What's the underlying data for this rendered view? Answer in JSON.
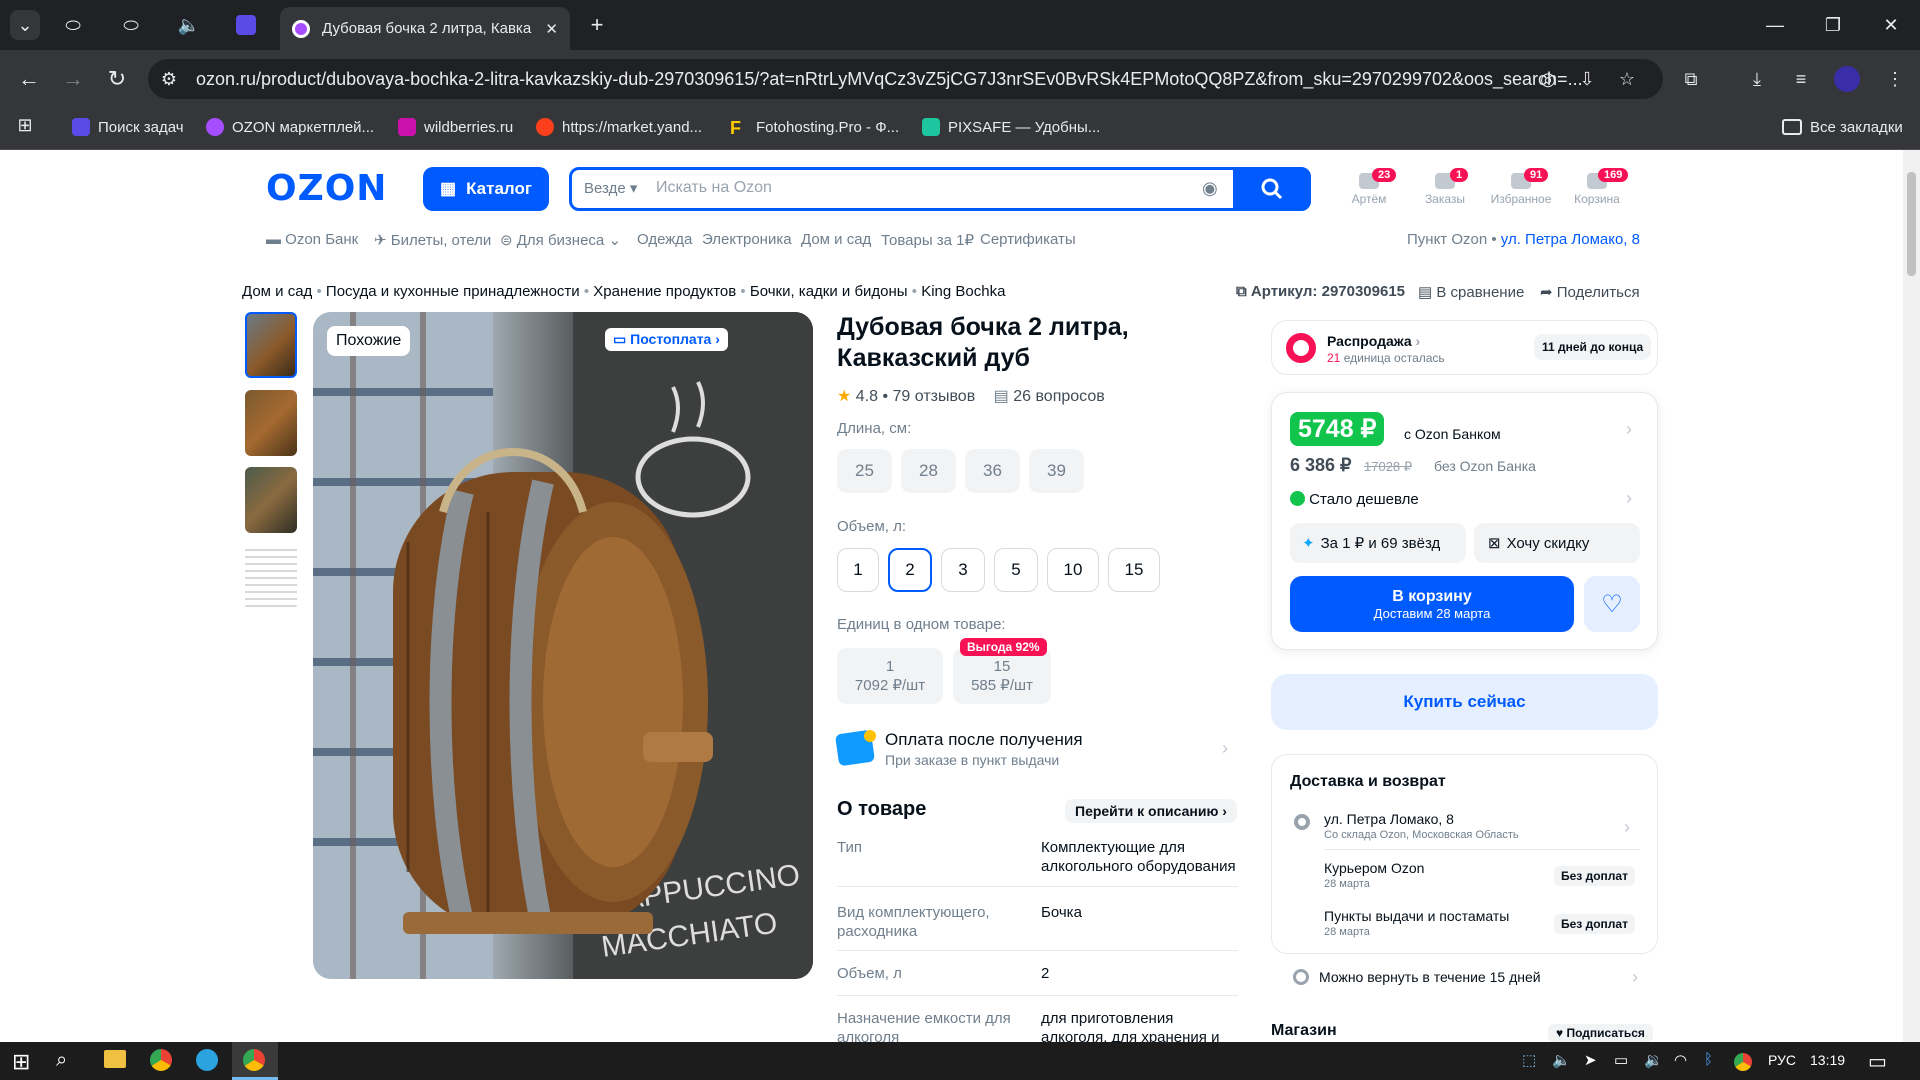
{
  "browser": {
    "tab_title": "Дубовая бочка 2 литра, Кавка",
    "url": "ozon.ru/product/dubovaya-bochka-2-litra-kavkazskiy-dub-2970309615/?at=nRtrLyMVqCz3vZ5jCG7J3nrSEv0BvRSk4EPMotoQQ8PZ&from_sku=2970299702&oos_search=...",
    "bookmarks": [
      "Поиск задач",
      "OZON маркетплей...",
      "wildberries.ru",
      "https://market.yand...",
      "Fotohosting.Pro - Ф...",
      "PIXSAFE — Удобны..."
    ],
    "all_bookmarks": "Все закладки"
  },
  "header": {
    "logo": "OZON",
    "catalog": "Каталог",
    "search_scope": "Везде",
    "search_placeholder": "Искать на Ozon",
    "icons": [
      {
        "label": "Артём",
        "count": "23"
      },
      {
        "label": "Заказы",
        "count": "1"
      },
      {
        "label": "Избранное",
        "count": "91"
      },
      {
        "label": "Корзина",
        "count": "169"
      }
    ],
    "nav": [
      "Ozon Банк",
      "Билеты, отели",
      "Для бизнеса",
      "Одежда",
      "Электроника",
      "Дом и сад",
      "Товары за 1₽",
      "Сертификаты"
    ],
    "pickup_label": "Пункт Ozon •",
    "pickup_address": "ул. Петра Ломако, 8"
  },
  "breadcrumbs": [
    "Дом и сад",
    "Посуда и кухонные принадлежности",
    "Хранение продуктов",
    "Бочки, кадки и бидоны",
    "King Bochka"
  ],
  "article": "Артикул: 2970309615",
  "compare": "В сравнение",
  "share": "Поделиться",
  "gallery": {
    "similar": "Похожие",
    "postpay": "Постоплата"
  },
  "product": {
    "title_line1": "Дубовая бочка 2 литра,",
    "title_line2": "Кавказский дуб",
    "rating": "4.8 • 79 отзывов",
    "questions": "26 вопросов",
    "length_label": "Длина, см:",
    "lengths": [
      "25",
      "28",
      "36",
      "39"
    ],
    "volume_label": "Объем, л:",
    "volumes": [
      "1",
      "2",
      "3",
      "5",
      "10",
      "15"
    ],
    "selected_volume": "2",
    "units_label": "Единиц в одном товаре:",
    "units": [
      {
        "count": "1",
        "price": "7092 ₽/шт"
      },
      {
        "count": "15",
        "price": "585 ₽/шт",
        "badge": "Выгода 92%"
      }
    ],
    "payment_title": "Оплата после получения",
    "payment_sub": "При заказе в пункт выдачи",
    "about_title": "О товаре",
    "about_link": "Перейти к описанию",
    "specs": [
      {
        "k": "Тип",
        "v": "Комплектующие для алкогольного оборудования"
      },
      {
        "k": "Вид комплектующего, расходника",
        "v": "Бочка"
      },
      {
        "k": "Объем, л",
        "v": "2"
      },
      {
        "k": "Назначение емкости для алкоголя",
        "v": "для приготовления алкоголя, для хранения и"
      }
    ]
  },
  "sale": {
    "title": "Распродажа",
    "count": "21",
    "left": "единица осталась",
    "days": "11 дней до конца"
  },
  "price": {
    "bank_price": "5748 ₽",
    "bank_label": "с Ozon Банком",
    "price": "6 386 ₽",
    "old_price": "17028 ₽",
    "no_bank": "без Ozon Банка",
    "cheaper": "Стало дешевле",
    "stars": "За 1 ₽ и 69 звёзд",
    "discount": "Хочу скидку",
    "cart": "В корзину",
    "cart_sub": "Доставим 28 марта",
    "buy_now": "Купить сейчас"
  },
  "delivery": {
    "title": "Доставка и возврат",
    "address": "ул. Петра Ломако, 8",
    "address_sub": "Со склада Ozon, Московская Область",
    "courier": "Курьером Ozon",
    "courier_date": "28 марта",
    "courier_price": "Без доплат",
    "points": "Пункты выдачи и постаматы",
    "points_date": "28 марта",
    "points_price": "Без доплат",
    "return": "Можно вернуть в течение 15 дней"
  },
  "shop": {
    "title": "Магазин",
    "subscribe": "Подписаться"
  },
  "taskbar": {
    "lang": "РУС",
    "time": "13:19"
  }
}
